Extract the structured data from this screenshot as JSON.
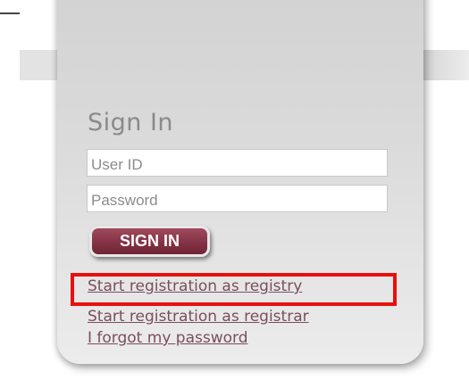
{
  "signin": {
    "title": "Sign In",
    "user_id_placeholder": "User ID",
    "password_placeholder": "Password",
    "button_label": "SIGN IN"
  },
  "links": {
    "registry": "Start registration as registry",
    "registrar": "Start registration as registrar",
    "forgot": "I forgot my password"
  },
  "colors": {
    "button": "#843246",
    "link": "#7a4f5c",
    "highlight": "#e8100e",
    "title": "#8a8a8a"
  }
}
